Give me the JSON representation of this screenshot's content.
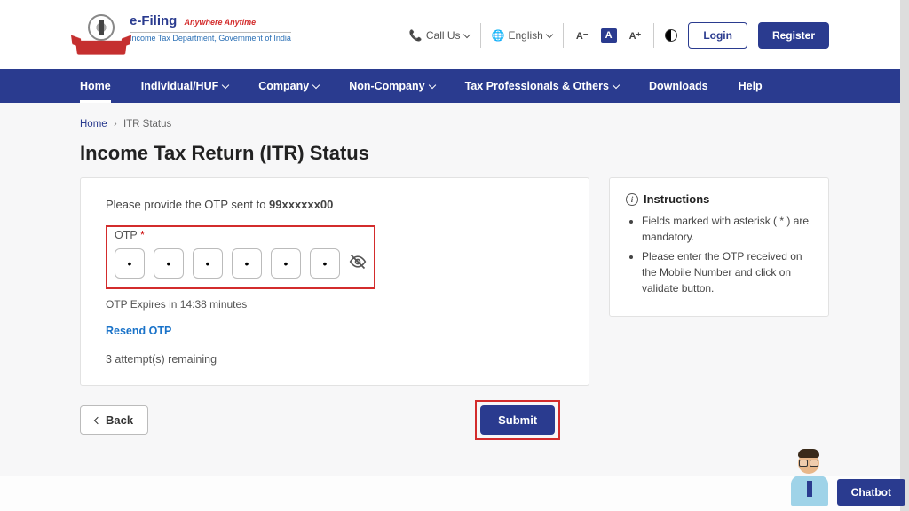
{
  "header": {
    "brand_main": "e-Filing",
    "brand_tag": "Anywhere Anytime",
    "brand_sub": "Income Tax Department, Government of India",
    "call_us": "Call Us",
    "language": "English",
    "font_small": "A⁻",
    "font_normal": "A",
    "font_large": "A⁺",
    "login": "Login",
    "register": "Register"
  },
  "nav": {
    "home": "Home",
    "individual": "Individual/HUF",
    "company": "Company",
    "noncompany": "Non-Company",
    "taxpro": "Tax Professionals & Others",
    "downloads": "Downloads",
    "help": "Help"
  },
  "breadcrumb": {
    "home": "Home",
    "current": "ITR Status"
  },
  "page_title": "Income Tax Return (ITR) Status",
  "otp": {
    "intro_prefix": "Please provide the OTP sent to ",
    "intro_mobile": "99xxxxxx00",
    "label": "OTP",
    "asterisk": "*",
    "v1": "•",
    "v2": "•",
    "v3": "•",
    "v4": "•",
    "v5": "•",
    "v6": "•",
    "expire": "OTP Expires in 14:38 minutes",
    "resend": "Resend OTP",
    "attempts": "3 attempt(s) remaining"
  },
  "instructions": {
    "title": "Instructions",
    "item1": "Fields marked with asterisk ( * ) are mandatory.",
    "item2": "Please enter the OTP received on the Mobile Number and click on validate button."
  },
  "actions": {
    "back": "Back",
    "submit": "Submit"
  },
  "chatbot": "Chatbot"
}
